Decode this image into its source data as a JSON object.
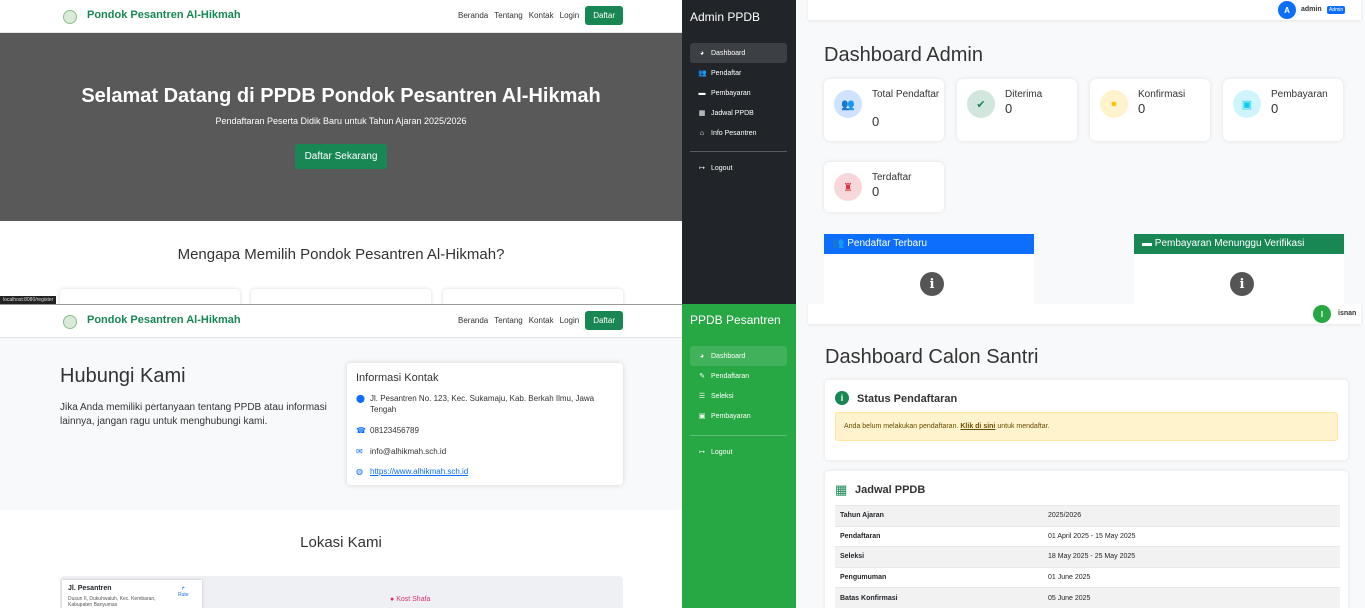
{
  "landing": {
    "brand": "Pondok Pesantren Al-Hikmah",
    "nav": [
      "Beranda",
      "Tentang",
      "Kontak",
      "Login"
    ],
    "daftar_btn": "Daftar",
    "hero_title": "Selamat Datang di PPDB Pondok Pesantren Al-Hikmah",
    "hero_subtitle": "Pendaftaran Peserta Didik Baru untuk Tahun Ajaran 2025/2026",
    "hero_cta": "Daftar Sekarang",
    "why_title": "Mengapa Memilih Pondok Pesantren Al-Hikmah?",
    "status_url": "localhost:8080/register"
  },
  "admin": {
    "sidebar_title": "Admin PPDB",
    "menu": [
      "Dashboard",
      "Pendaftar",
      "Pembayaran",
      "Jadwal PPDB",
      "Info Pesantren"
    ],
    "logout": "Logout",
    "user_initial": "A",
    "user_name": "admin",
    "user_badge": "Admin",
    "title": "Dashboard Admin",
    "stats": [
      {
        "label": "Total Pendaftar",
        "value": "0"
      },
      {
        "label": "Diterima",
        "value": "0"
      },
      {
        "label": "Konfirmasi",
        "value": "0"
      },
      {
        "label": "Pembayaran",
        "value": "0"
      },
      {
        "label": "Terdaftar",
        "value": "0"
      }
    ],
    "panel_left": "Pendaftar Terbaru",
    "panel_right": "Pembayaran Menunggu Verifikasi",
    "colors": {
      "sidebar": "#212529",
      "primary": "#0d6efd",
      "success": "#198754"
    }
  },
  "contact": {
    "title": "Hubungi Kami",
    "desc": "Jika Anda memiliki pertanyaan tentang PPDB atau informasi lainnya, jangan ragu untuk menghubungi kami.",
    "info_title": "Informasi Kontak",
    "address": "Jl. Pesantren No. 123, Kec. Sukamaju, Kab. Berkah Ilmu, Jawa Tengah",
    "phone": "08123456789",
    "email": "info@alhikmah.sch.id",
    "website": "https://www.alhikmah.sch.id",
    "lokasi_title": "Lokasi Kami",
    "map_place": "Jl. Pesantren",
    "map_address": "Dusun II, Dukuhwaluh, Kec. Kembaran, Kabupaten Banyumas",
    "map_route": "Rute",
    "map_poi": "Kost Shafa"
  },
  "santri": {
    "sidebar_title": "PPDB Pesantren",
    "menu": [
      "Dashboard",
      "Pendaftaran",
      "Seleksi",
      "Pembayaran"
    ],
    "logout": "Logout",
    "user_initial": "I",
    "user_name": "isnan",
    "title": "Dashboard Calon Santri",
    "status_title": "Status Pendaftaran",
    "alert_text": "Anda belum melakukan pendaftaran.",
    "alert_link": "Klik di sini",
    "alert_suffix": "untuk mendaftar.",
    "jadwal_title": "Jadwal PPDB",
    "jadwal": [
      {
        "label": "Tahun Ajaran",
        "value": "2025/2026"
      },
      {
        "label": "Pendaftaran",
        "value": "01 April 2025 - 15 May 2025"
      },
      {
        "label": "Seleksi",
        "value": "18 May 2025 - 25 May 2025"
      },
      {
        "label": "Pengumuman",
        "value": "01 June 2025"
      },
      {
        "label": "Batas Konfirmasi",
        "value": "05 June 2025"
      }
    ],
    "colors": {
      "sidebar": "#28a745"
    }
  }
}
